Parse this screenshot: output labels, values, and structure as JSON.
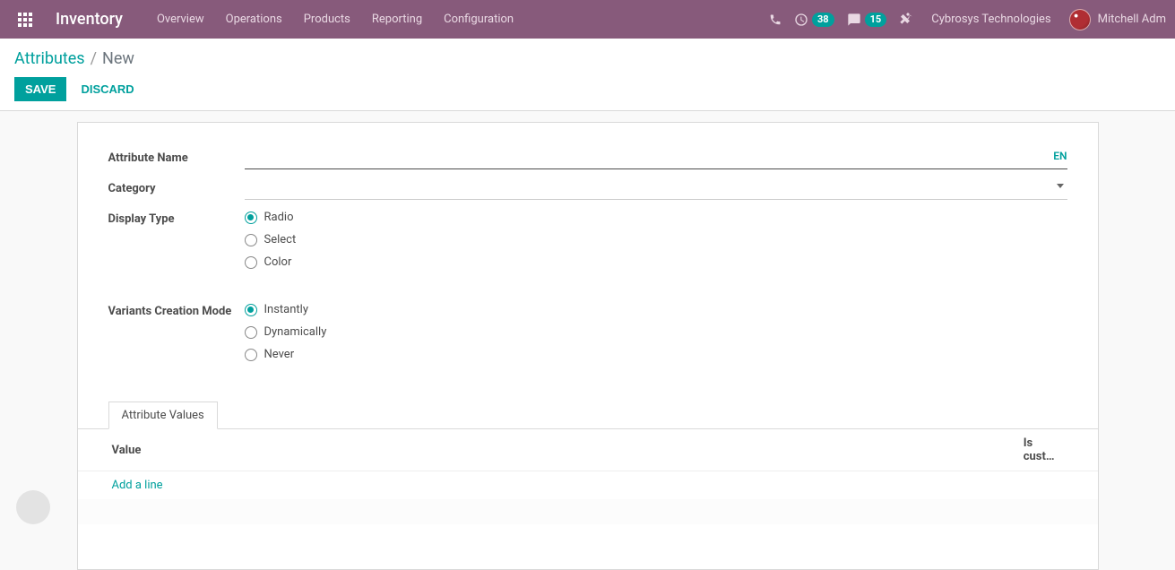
{
  "navbar": {
    "brand": "Inventory",
    "menus": [
      "Overview",
      "Operations",
      "Products",
      "Reporting",
      "Configuration"
    ],
    "activity_count": "38",
    "message_count": "15",
    "company": "Cybrosys Technologies",
    "user_name": "Mitchell Adm"
  },
  "control_panel": {
    "breadcrumb_parent": "Attributes",
    "breadcrumb_current": "New",
    "save_label": "SAVE",
    "discard_label": "DISCARD"
  },
  "form": {
    "labels": {
      "attribute_name": "Attribute Name",
      "category": "Category",
      "display_type": "Display Type",
      "variants_mode": "Variants Creation Mode"
    },
    "attribute_name_value": "",
    "lang_tag": "EN",
    "category_value": "",
    "display_type": {
      "options": [
        "Radio",
        "Select",
        "Color"
      ],
      "selected": "Radio"
    },
    "variants_mode": {
      "options": [
        "Instantly",
        "Dynamically",
        "Never"
      ],
      "selected": "Instantly"
    }
  },
  "tabs": {
    "attribute_values_label": "Attribute Values"
  },
  "table": {
    "col_value": "Value",
    "col_is_custom": "Is cust…",
    "add_line": "Add a line"
  }
}
